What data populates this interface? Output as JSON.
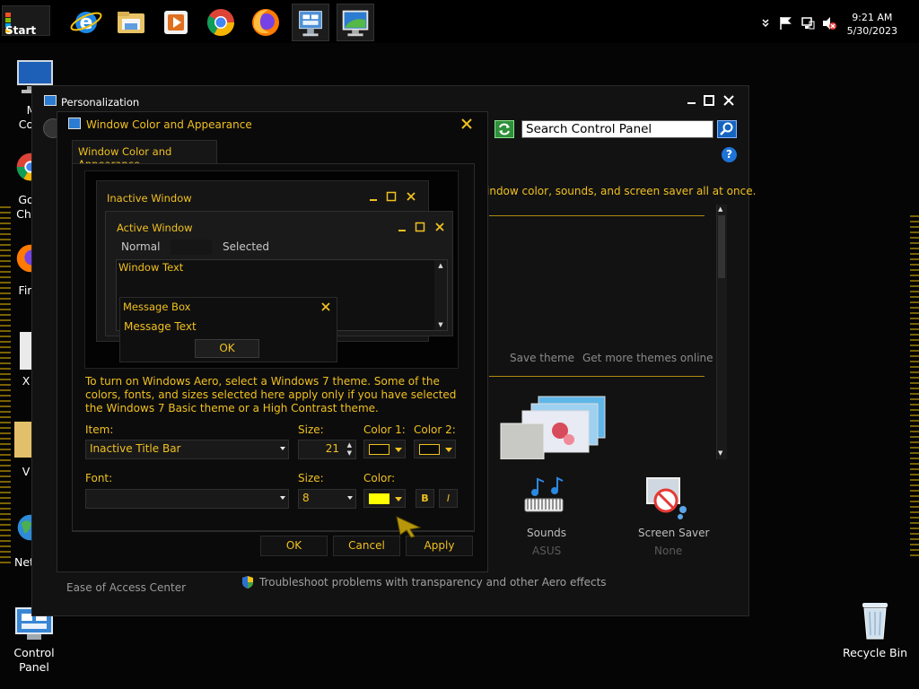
{
  "taskbar": {
    "start_label": "Start",
    "icons": [
      "internet-explorer-icon",
      "file-explorer-icon",
      "media-player-icon",
      "chrome-icon",
      "firefox-icon",
      "control-panel-icon",
      "personalization-icon"
    ],
    "clock": {
      "time": "9:21 AM",
      "date": "5/30/2023"
    }
  },
  "desktop": {
    "icons": [
      {
        "label": "M\nCom",
        "name": "computer"
      },
      {
        "label": "Go\nChr",
        "name": "google-chrome"
      },
      {
        "label": "Fir",
        "name": "firefox"
      },
      {
        "label": "X",
        "name": "x-file"
      },
      {
        "label": "V",
        "name": "v-folder"
      },
      {
        "label": "Net",
        "name": "network"
      }
    ],
    "control_panel_label": "Control\nPanel",
    "recycle_bin_label": "Recycle Bin"
  },
  "personalization": {
    "title": "Personalization",
    "search_placeholder": "Search Control Panel",
    "intro": "indow color, sounds, and screen saver all at once.",
    "save_theme": "Save theme",
    "more_themes": "Get more themes online",
    "sounds_label": "Sounds",
    "sounds_value": "ASUS",
    "screensaver_label": "Screen Saver",
    "screensaver_value": "None",
    "ease_access": "Ease of Access Center",
    "troubleshoot": "Troubleshoot problems with transparency and other Aero effects"
  },
  "dialog": {
    "title": "Window Color and Appearance",
    "tab": "Window Color and Appearance",
    "preview": {
      "inactive_title": "Inactive Window",
      "active_title": "Active Window",
      "normal": "Normal",
      "selected": "Selected",
      "window_text": "Window Text",
      "msgbox_title": "Message Box",
      "msgbox_text": "Message Text",
      "ok": "OK"
    },
    "note": "To turn on Windows Aero, select a Windows 7 theme.  Some of the colors, fonts, and sizes selected here apply only if you have selected the Windows 7 Basic theme or a High Contrast theme.",
    "item_label": "Item:",
    "item_value": "Inactive Title Bar",
    "size_label": "Size:",
    "item_size": "21",
    "color1_label": "Color 1:",
    "color2_label": "Color 2:",
    "font_label": "Font:",
    "font_value": "",
    "font_size_label": "Size:",
    "font_size": "8",
    "font_color_label": "Color:",
    "font_color": "#ffff00",
    "bold": "B",
    "italic": "I",
    "ok": "OK",
    "cancel": "Cancel",
    "apply": "Apply"
  }
}
